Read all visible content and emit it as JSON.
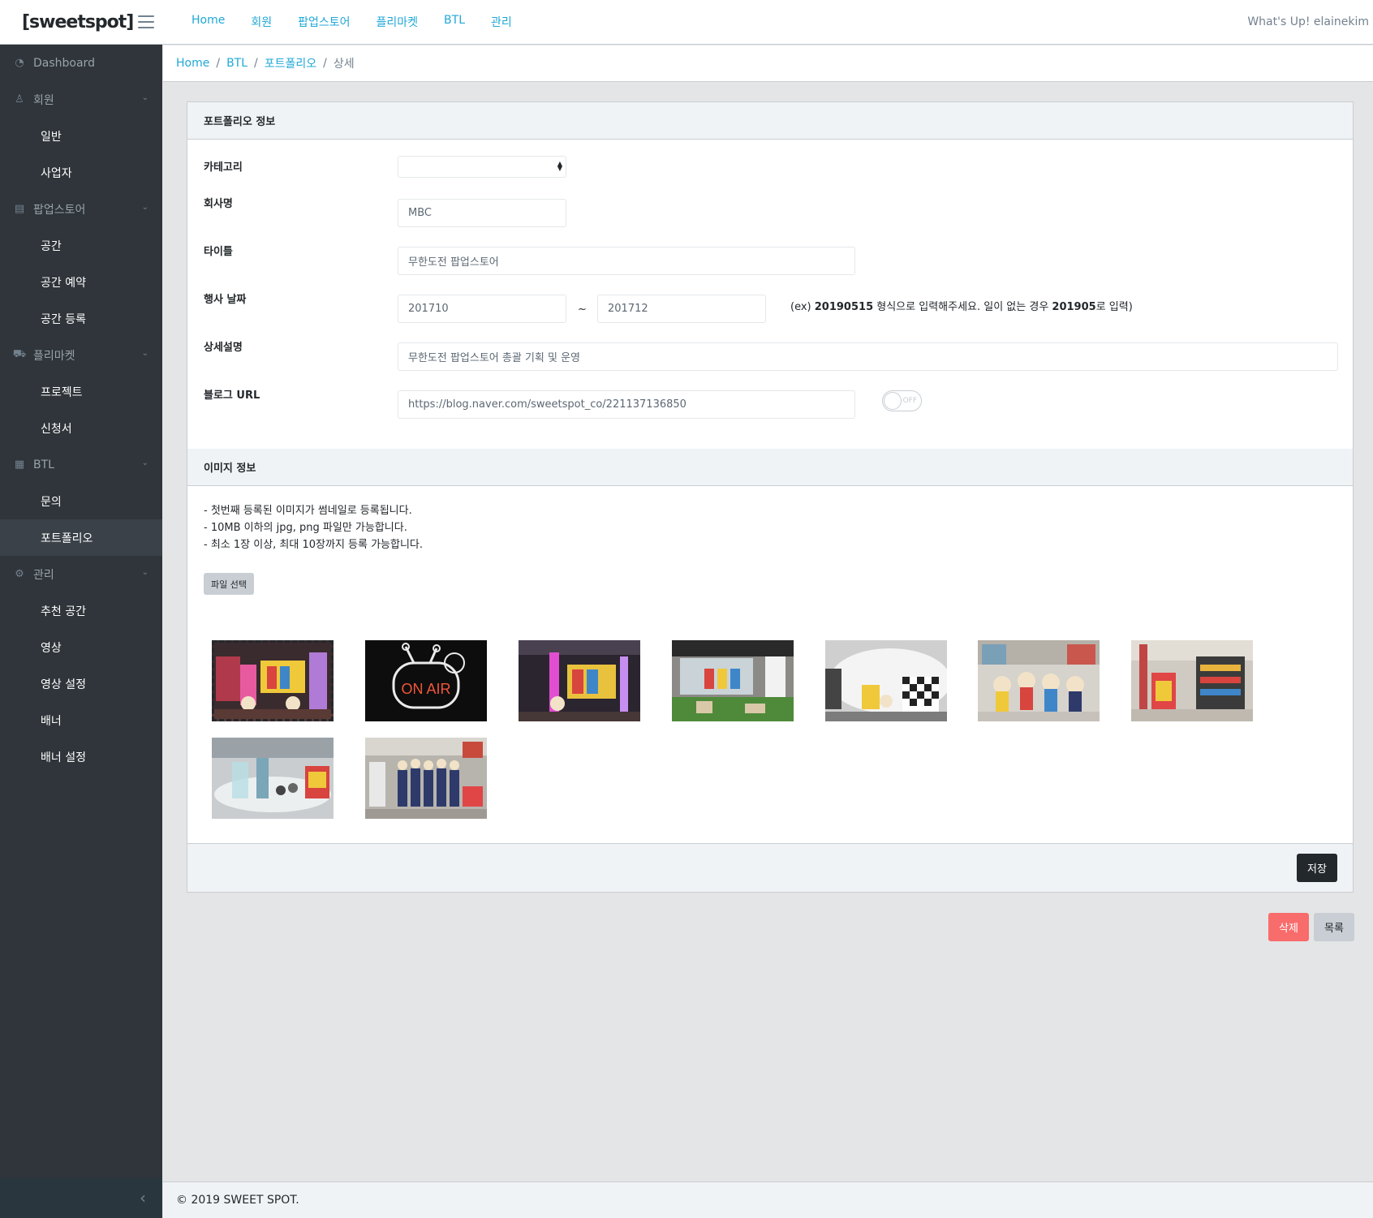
{
  "header": {
    "logo": "[sweetspot]",
    "nav": [
      "Home",
      "회원",
      "팝업스토어",
      "플리마켓",
      "BTL",
      "관리"
    ],
    "greeting": "What's Up! elainekim"
  },
  "sidebar": {
    "items": [
      {
        "label": "Dashboard",
        "icon": "speedometer-icon",
        "type": "parent"
      },
      {
        "label": "회원",
        "icon": "user-icon",
        "type": "parent",
        "caret": true
      },
      {
        "label": "일반",
        "type": "child"
      },
      {
        "label": "사업자",
        "type": "child"
      },
      {
        "label": "팝업스토어",
        "icon": "building-icon",
        "type": "parent",
        "caret": true
      },
      {
        "label": "공간",
        "type": "child"
      },
      {
        "label": "공간 예약",
        "type": "child"
      },
      {
        "label": "공간 등록",
        "type": "child"
      },
      {
        "label": "플리마켓",
        "icon": "cart-icon",
        "type": "parent",
        "caret": true
      },
      {
        "label": "프로젝트",
        "type": "child"
      },
      {
        "label": "신청서",
        "type": "child"
      },
      {
        "label": "BTL",
        "icon": "grid-icon",
        "type": "parent",
        "caret": true
      },
      {
        "label": "문의",
        "type": "child"
      },
      {
        "label": "포트폴리오",
        "type": "child",
        "active": true
      },
      {
        "label": "관리",
        "icon": "gear-icon",
        "type": "parent",
        "caret": true
      },
      {
        "label": "추천 공간",
        "type": "child"
      },
      {
        "label": "영상",
        "type": "child"
      },
      {
        "label": "영상 설정",
        "type": "child"
      },
      {
        "label": "배너",
        "type": "child"
      },
      {
        "label": "배너 설정",
        "type": "child"
      }
    ]
  },
  "breadcrumb": {
    "items": [
      "Home",
      "BTL",
      "포트폴리오"
    ],
    "current": "상세"
  },
  "portfolio": {
    "header": "포트폴리오 정보",
    "category_label": "카테고리",
    "category_value": "",
    "company_label": "회사명",
    "company_value": "MBC",
    "title_label": "타이틀",
    "title_value": "무한도전 팝업스토어",
    "date_label": "행사 날짜",
    "date_start": "201710",
    "date_tilde": "~",
    "date_end": "201712",
    "date_hint_pre": "(ex) ",
    "date_hint_ex1": "20190515",
    "date_hint_mid": " 형식으로 입력해주세요. 일이 없는 경우 ",
    "date_hint_ex2": "201905",
    "date_hint_post": "로 입력)",
    "desc_label": "상세설명",
    "desc_value": "무한도전 팝업스토어 총괄 기획 및 운영",
    "blog_label": "블로그 URL",
    "blog_value": "https://blog.naver.com/sweetspot_co/221137136850",
    "toggle_text": "OFF",
    "toggle_on": false
  },
  "images": {
    "header": "이미지 정보",
    "notes": [
      "- 첫번째 등록된 이미지가 썸네일로 등록됩니다.",
      "- 10MB 이하의 jpg, png 파일만 가능합니다.",
      "- 최소 1장 이상, 최대 10장까지 등록 가능합니다."
    ],
    "file_button": "파일 선택",
    "thumbnails": [
      {
        "name": "thumbnail-1",
        "thumbnail": true
      },
      {
        "name": "thumbnail-2",
        "text": "ON AIR"
      },
      {
        "name": "thumbnail-3"
      },
      {
        "name": "thumbnail-4"
      },
      {
        "name": "thumbnail-5"
      },
      {
        "name": "thumbnail-6"
      },
      {
        "name": "thumbnail-7"
      },
      {
        "name": "thumbnail-8"
      },
      {
        "name": "thumbnail-9"
      }
    ]
  },
  "actions": {
    "save": "저장",
    "delete": "삭제",
    "list": "목록"
  },
  "footer": {
    "text": "© 2019 SWEET SPOT."
  },
  "colors": {
    "link": "#20a8d8",
    "sidebar_bg": "#2f353a",
    "danger": "#f86c6b",
    "dark": "#23282c",
    "light": "#c8ced3"
  }
}
